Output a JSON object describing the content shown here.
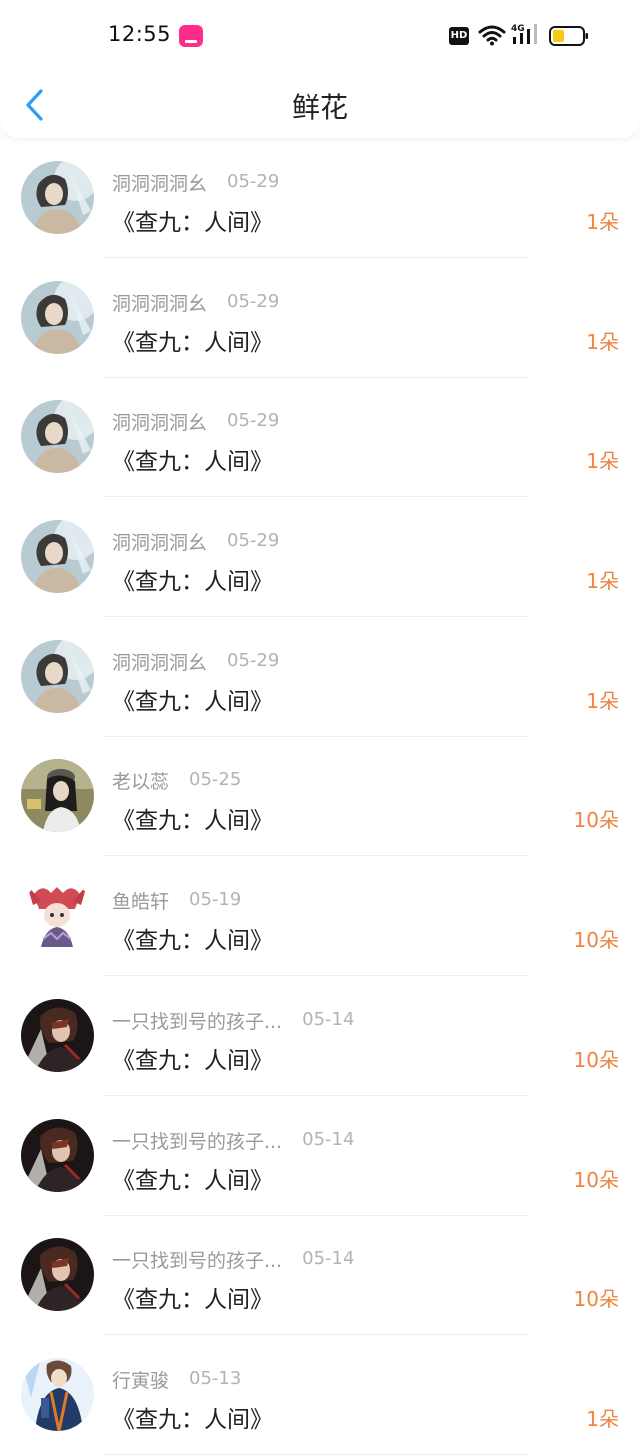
{
  "status_bar": {
    "time": "12:55",
    "hd_label": "HD",
    "network_label": "4G"
  },
  "header": {
    "title": "鲜花"
  },
  "colors": {
    "accent_blue": "#2e9cf2",
    "amount_orange": "#ee8440",
    "name_gray": "#9a9a9a",
    "battery_yellow": "#f6c915"
  },
  "items": [
    {
      "name": "洞洞洞洞幺",
      "date": "05-29",
      "title": "《查九：人间》",
      "amount": "1朵",
      "avatar": "avatar-pale-girl-icon"
    },
    {
      "name": "洞洞洞洞幺",
      "date": "05-29",
      "title": "《查九：人间》",
      "amount": "1朵",
      "avatar": "avatar-pale-girl-icon"
    },
    {
      "name": "洞洞洞洞幺",
      "date": "05-29",
      "title": "《查九：人间》",
      "amount": "1朵",
      "avatar": "avatar-pale-girl-icon"
    },
    {
      "name": "洞洞洞洞幺",
      "date": "05-29",
      "title": "《查九：人间》",
      "amount": "1朵",
      "avatar": "avatar-pale-girl-icon"
    },
    {
      "name": "洞洞洞洞幺",
      "date": "05-29",
      "title": "《查九：人间》",
      "amount": "1朵",
      "avatar": "avatar-pale-girl-icon"
    },
    {
      "name": "老以蕊",
      "date": "05-25",
      "title": "《查九：人间》",
      "amount": "10朵",
      "avatar": "avatar-photo-girl-icon"
    },
    {
      "name": "鱼皓轩",
      "date": "05-19",
      "title": "《查九：人间》",
      "amount": "10朵",
      "avatar": "avatar-red-hair-chibi-icon"
    },
    {
      "name": "一只找到号的孩子...",
      "date": "05-14",
      "title": "《查九：人间》",
      "amount": "10朵",
      "avatar": "avatar-dark-anime-icon"
    },
    {
      "name": "一只找到号的孩子...",
      "date": "05-14",
      "title": "《查九：人间》",
      "amount": "10朵",
      "avatar": "avatar-dark-anime-icon"
    },
    {
      "name": "一只找到号的孩子...",
      "date": "05-14",
      "title": "《查九：人间》",
      "amount": "10朵",
      "avatar": "avatar-dark-anime-icon"
    },
    {
      "name": "行寅骏",
      "date": "05-13",
      "title": "《查九：人间》",
      "amount": "1朵",
      "avatar": "avatar-blue-jacket-icon"
    }
  ]
}
